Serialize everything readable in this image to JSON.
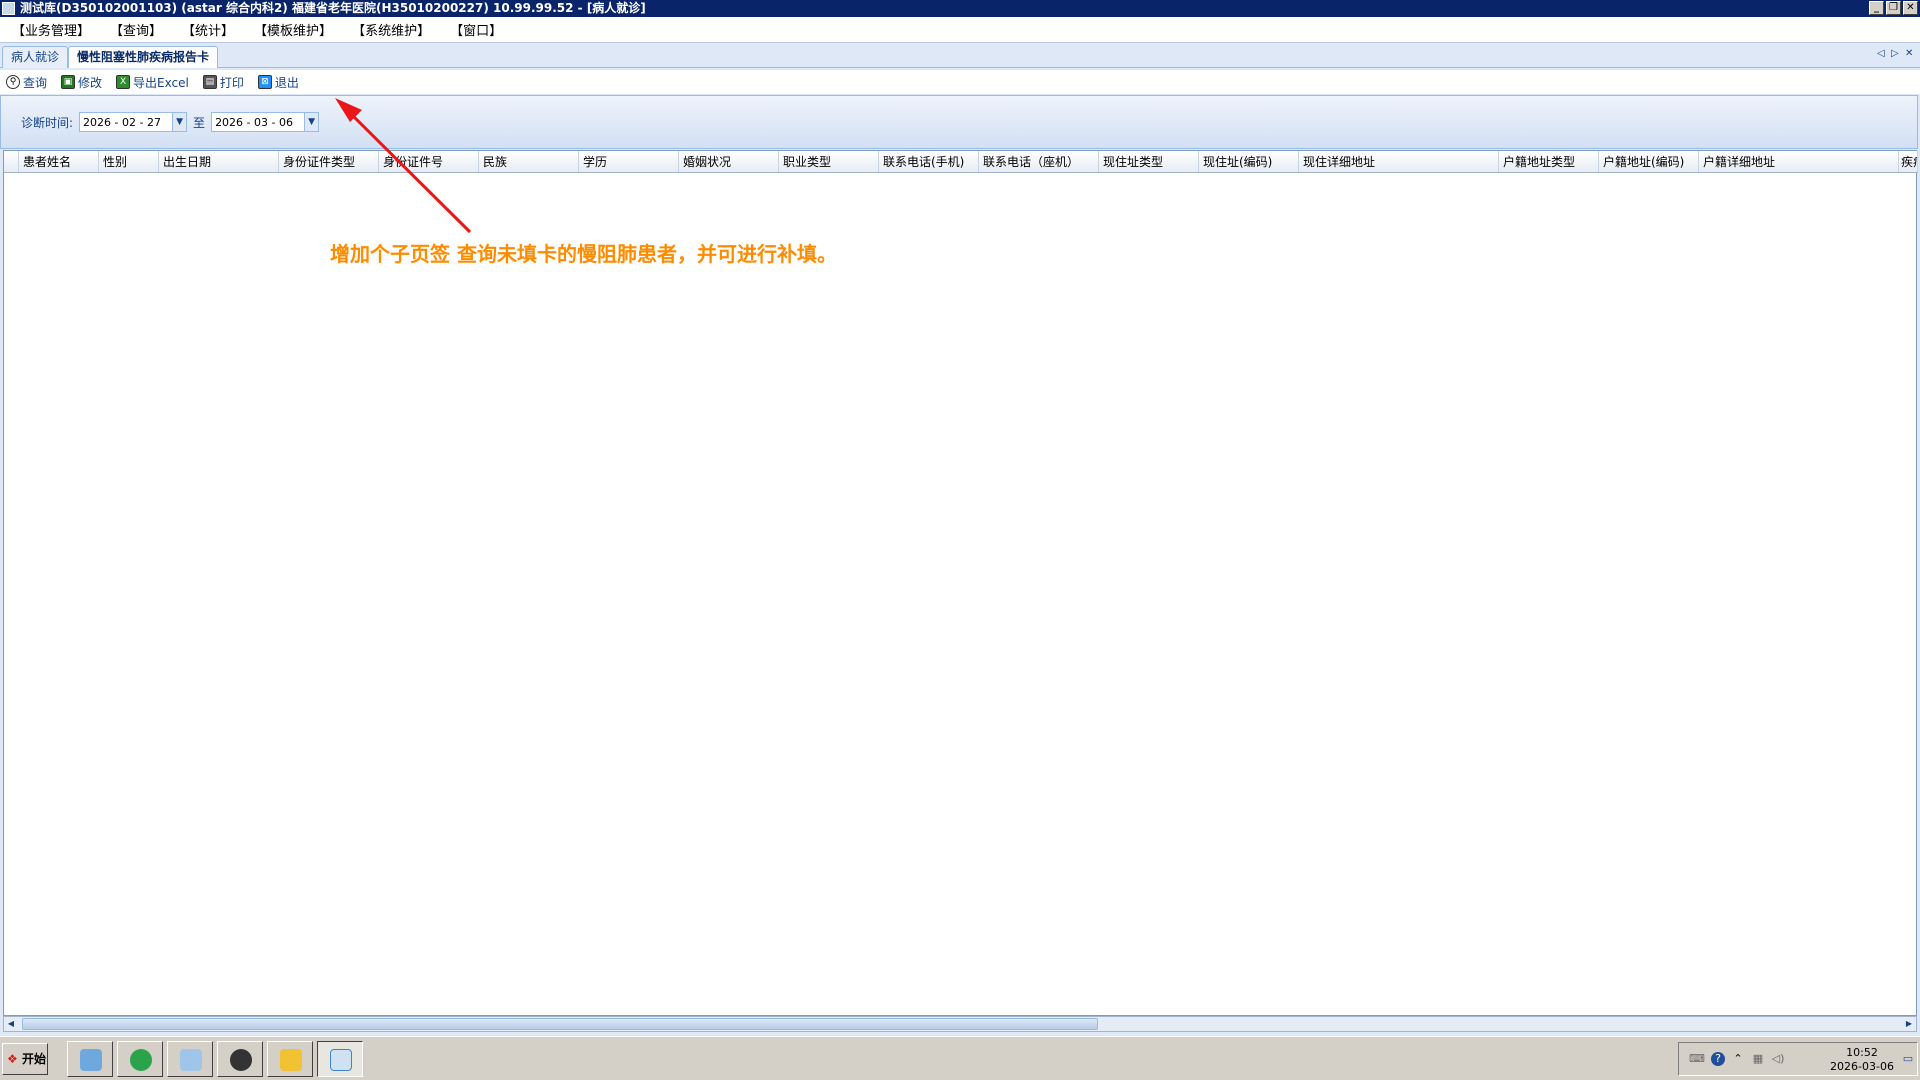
{
  "window": {
    "title": "测试库(D350102001103) (astar 综合内科2) 福建省老年医院(H35010200227) 10.99.99.52 - [病人就诊]",
    "controls": [
      "_",
      "❐",
      "✕"
    ]
  },
  "menu": [
    "【业务管理】",
    "【查询】",
    "【统计】",
    "【模板维护】",
    "【系统维护】",
    "【窗口】"
  ],
  "tabs": [
    {
      "label": "病人就诊",
      "active": false
    },
    {
      "label": "慢性阻塞性肺疾病报告卡",
      "active": true
    }
  ],
  "tab_controls": [
    "◁",
    "▷",
    "✕"
  ],
  "toolbar": [
    {
      "label": "查询",
      "icon": "search-icon"
    },
    {
      "label": "修改",
      "icon": "save-icon"
    },
    {
      "label": "导出Excel",
      "icon": "excel-icon"
    },
    {
      "label": "打印",
      "icon": "printer-icon"
    },
    {
      "label": "退出",
      "icon": "exit-icon"
    }
  ],
  "filter": {
    "label": "诊断时间:",
    "from_date": "2026 - 02 - 27",
    "separator": "至",
    "to_date": "2026 - 03 - 06"
  },
  "grid": {
    "columns": [
      "患者姓名",
      "性别",
      "出生日期",
      "身份证件类型",
      "身份证件号",
      "民族",
      "学历",
      "婚姻状况",
      "职业类型",
      "联系电话(手机)",
      "联系电话（座机）",
      "现住址类型",
      "现住址(编码)",
      "现住详细地址",
      "户籍地址类型",
      "户籍地址(编码)",
      "户籍详细地址",
      "疾病"
    ],
    "rows": []
  },
  "annotation": {
    "text": "增加个子页签 查询未填卡的慢阻肺患者，并可进行补填。",
    "color": "#ff8c00",
    "arrow_color": "#e81818"
  },
  "taskbar": {
    "start_label": "开始",
    "apps": [
      "calculator-icon",
      "sogou-icon",
      "notepad-icon",
      "compass-icon",
      "folder-icon",
      "doctor-app-icon"
    ],
    "clock_time": "10:52",
    "clock_date": "2026-03-06"
  }
}
